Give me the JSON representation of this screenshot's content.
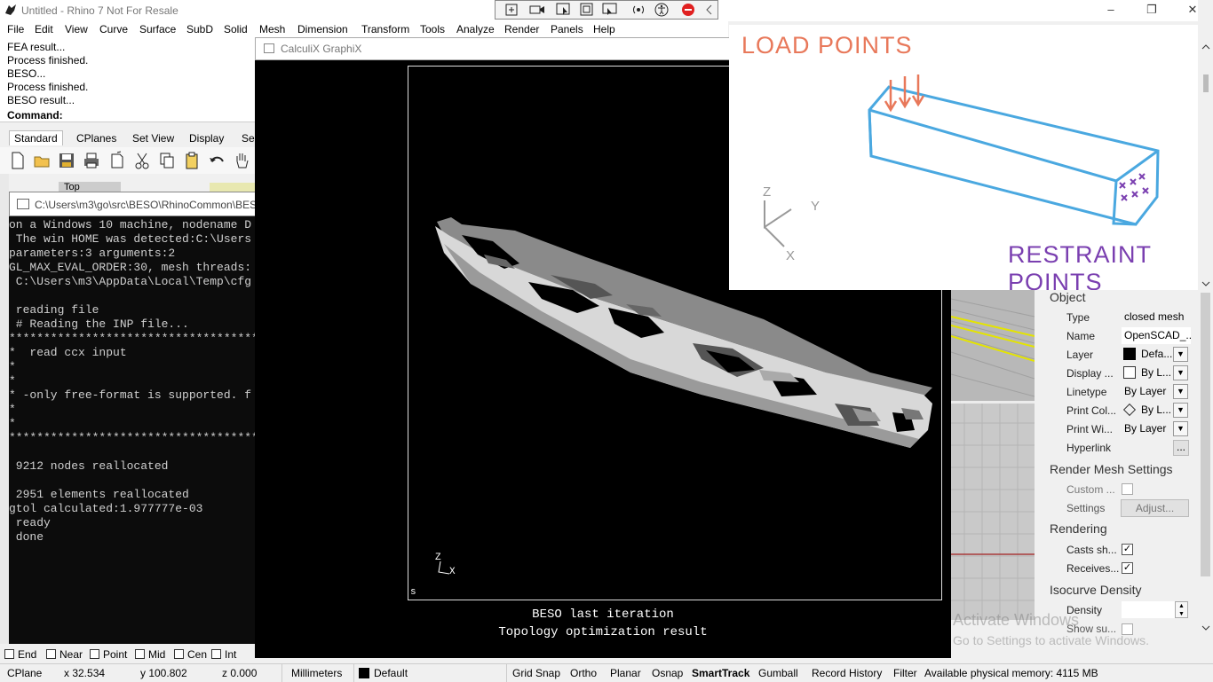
{
  "app": {
    "title": "Untitled - Rhino 7 Not For Resale"
  },
  "menu": [
    "File",
    "Edit",
    "View",
    "Curve",
    "Surface",
    "SubD",
    "Solid",
    "Mesh",
    "Dimension",
    "Transform",
    "Tools",
    "Analyze",
    "Render",
    "Panels",
    "Help"
  ],
  "history": [
    "FEA result...",
    "Process finished.",
    "BESO...",
    "Process finished.",
    "BESO result..."
  ],
  "command_label": "Command:",
  "tabs": [
    "Standard",
    "CPlanes",
    "Set View",
    "Display",
    "Sel"
  ],
  "viewport_label": "Top",
  "console": {
    "title": "C:\\Users\\m3\\go\\src\\BESO\\RhinoCommon\\BES",
    "lines": [
      "on a Windows 10 machine, nodename D",
      " The win HOME was detected:C:\\Users",
      "parameters:3 arguments:2",
      "GL_MAX_EVAL_ORDER:30, mesh threads:",
      " C:\\Users\\m3\\AppData\\Local\\Temp\\cfg",
      "",
      " reading file",
      " # Reading the INP file...",
      "**************************************",
      "*  read ccx input",
      "*",
      "*",
      "* -only free-format is supported. f",
      "*",
      "*",
      "**************************************",
      "",
      " 9212 nodes reallocated",
      "",
      " 2951 elements reallocated",
      "gtol calculated:1.977777e-03",
      " ready",
      " done"
    ]
  },
  "snap": [
    "End",
    "Near",
    "Point",
    "Mid",
    "Cen",
    "Int"
  ],
  "cgx": {
    "title": "CalculiX GraphiX",
    "line1": "BESO last iteration",
    "line2": "Topology optimization result",
    "axis_z": "Z",
    "axis_x": "X",
    "corner": "s"
  },
  "sketch": {
    "load": "LOAD POINTS",
    "restraint": "RESTRAINT POINTS",
    "axis_z": "Z",
    "axis_y": "Y",
    "axis_x": "X"
  },
  "properties": {
    "object_header": "Object",
    "rows": [
      {
        "label": "Type",
        "value": "closed mesh"
      },
      {
        "label": "Name",
        "value": "OpenSCAD_..."
      },
      {
        "label": "Layer",
        "value": "Defa..."
      },
      {
        "label": "Display ...",
        "value": "By L..."
      },
      {
        "label": "Linetype",
        "value": "By Layer"
      },
      {
        "label": "Print Col...",
        "value": "By L..."
      },
      {
        "label": "Print Wi...",
        "value": "By Layer"
      },
      {
        "label": "Hyperlink",
        "value": ""
      }
    ],
    "hyperlink_btn": "...",
    "render_mesh_header": "Render Mesh Settings",
    "custom_label": "Custom ...",
    "settings_label": "Settings",
    "adjust_btn": "Adjust...",
    "rendering_header": "Rendering",
    "casts_label": "Casts sh...",
    "receives_label": "Receives...",
    "isocurve_header": "Isocurve Density",
    "density_label": "Density",
    "show_label": "Show su..."
  },
  "watermark": {
    "line1": "Activate Windows",
    "line2": "Go to Settings to activate Windows."
  },
  "status": {
    "cplane": "CPlane",
    "x": "x 32.534",
    "y": "y 100.802",
    "z": "z 0.000",
    "units": "Millimeters",
    "layer": "Default",
    "toggles": [
      "Grid Snap",
      "Ortho",
      "Planar",
      "Osnap",
      "SmartTrack",
      "Gumball",
      "Record History",
      "Filter"
    ],
    "memory": "Available physical memory: 4115 MB"
  },
  "colors": {
    "sketch_orange": "#e8785a",
    "sketch_blue": "#4aa8e0",
    "sketch_purple": "#7a3fb0",
    "grey_light": "#cfcfcf",
    "grey_dark": "#8a8a8a"
  }
}
